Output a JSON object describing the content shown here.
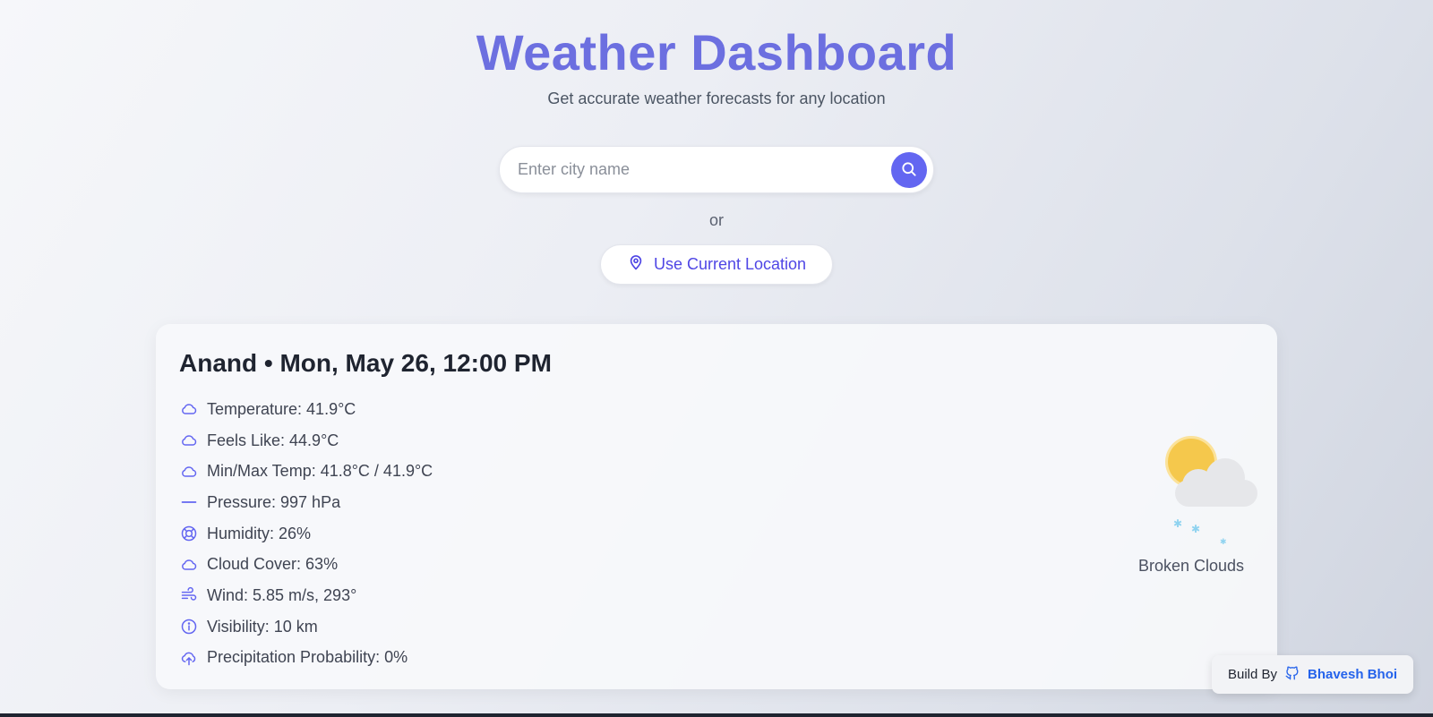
{
  "header": {
    "title": "Weather Dashboard",
    "subtitle": "Get accurate weather forecasts for any location"
  },
  "search": {
    "placeholder": "Enter city name",
    "value": "",
    "button_icon": "search-icon"
  },
  "or_text": "or",
  "location_button": {
    "label": "Use Current Location",
    "icon": "location-pin-icon"
  },
  "weather": {
    "heading": "Anand • Mon, May 26, 12:00 PM",
    "details": [
      {
        "icon": "cloud-icon",
        "text": "Temperature: 41.9°C"
      },
      {
        "icon": "cloud-icon",
        "text": "Feels Like: 44.9°C"
      },
      {
        "icon": "cloud-icon",
        "text": "Min/Max Temp: 41.8°C / 41.9°C"
      },
      {
        "icon": "dash-icon",
        "text": "Pressure: 997 hPa"
      },
      {
        "icon": "lifebuoy-icon",
        "text": "Humidity: 26%"
      },
      {
        "icon": "cloud-icon",
        "text": "Cloud Cover: 63%"
      },
      {
        "icon": "wind-icon",
        "text": "Wind: 5.85 m/s, 293°"
      },
      {
        "icon": "info-icon",
        "text": "Visibility: 10 km"
      },
      {
        "icon": "cloud-upload-icon",
        "text": "Precipitation Probability: 0%"
      }
    ],
    "condition": "Broken Clouds",
    "condition_icon": "sun-cloud-icon"
  },
  "credit": {
    "prefix": "Build By",
    "name": "Bhavesh Bhoi",
    "icon": "github-icon"
  },
  "colors": {
    "accent": "#6366f1",
    "title": "#6c6fe0",
    "link": "#2563eb"
  }
}
